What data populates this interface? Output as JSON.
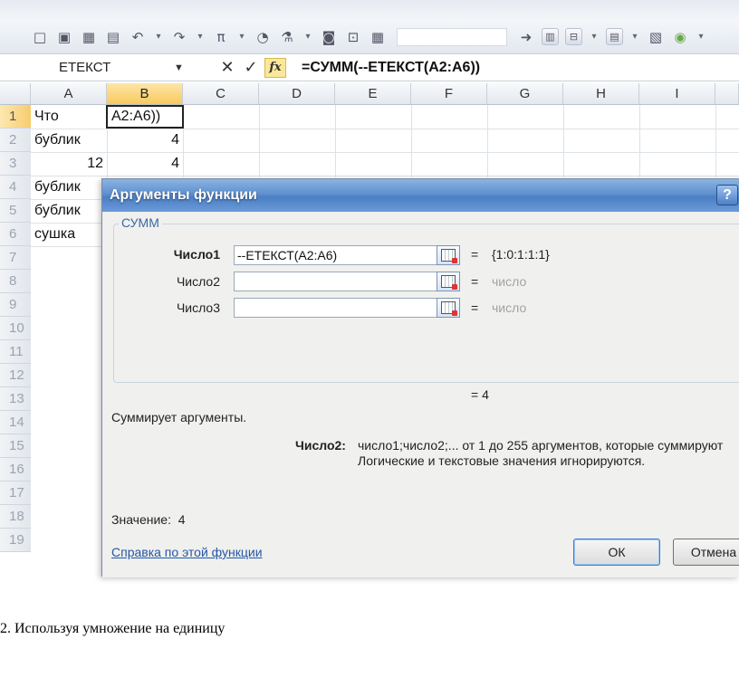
{
  "toolbar": {
    "icons": [
      "document-icon",
      "save-icon",
      "print-icon",
      "print-preview-icon",
      "undo-icon",
      "redo-icon",
      "pi-icon",
      "chart-icon",
      "filter-icon",
      "camera-icon",
      "lock-icon",
      "grid-icon",
      "arrow-right-icon",
      "fill-icon",
      "sort-icon",
      "format-icon",
      "macro-icon",
      "circle-icon",
      "customize-icon"
    ],
    "glyphs": {
      "document": "□",
      "save": "▣",
      "print": "▦",
      "preview": "▤",
      "undo": "↶",
      "redo": "↷",
      "pi": "π",
      "chart": "◔",
      "filter": "⚗",
      "camera": "◙",
      "lock": "⊡",
      "grid": "▦",
      "arrow": "➜",
      "fill": "▥",
      "sort": "⊟",
      "format": "▤",
      "macro": "▧",
      "circle": "◉",
      "more": "▾"
    }
  },
  "formula_bar": {
    "name_box": "ЕТЕКСТ",
    "dropdown": "▼",
    "cancel": "✕",
    "enter": "✓",
    "fx": "fx",
    "formula": "=СУММ(--ЕТЕКСТ(A2:A6))"
  },
  "sheet": {
    "columns": [
      "A",
      "B",
      "C",
      "D",
      "E",
      "F",
      "G",
      "H",
      "I"
    ],
    "rows": [
      "1",
      "2",
      "3",
      "4",
      "5",
      "6",
      "7",
      "8",
      "9",
      "10",
      "11",
      "12",
      "13",
      "14",
      "15",
      "16",
      "17",
      "18",
      "19"
    ],
    "cells": {
      "a1": "Что",
      "b1": "A2:A6))",
      "a2": "бублик",
      "b2": "4",
      "a3": "12",
      "b3": "4",
      "a4": "бублик",
      "a5": "бублик",
      "a6": "сушка"
    }
  },
  "dialog": {
    "title": "Аргументы функции",
    "help": "?",
    "function_name": "СУММ",
    "args": [
      {
        "label": "Число1",
        "value": "--ЕТЕКСТ(A2:A6)",
        "eq": "=",
        "result": "{1:0:1:1:1}"
      },
      {
        "label": "Число2",
        "value": "",
        "eq": "=",
        "result": "число"
      },
      {
        "label": "Число3",
        "value": "",
        "eq": "=",
        "result": "число"
      }
    ],
    "total": "=  4",
    "description": "Суммирует аргументы.",
    "arg_desc_label": "Число2:",
    "arg_desc_line1": "число1;число2;... от 1 до 255 аргументов, которые суммируют",
    "arg_desc_line2": "Логические и текстовые значения игнорируются.",
    "value_label": "Значение:",
    "value": "4",
    "help_link": "Справка по этой функции",
    "ok": "ОК",
    "cancel": "Отмена"
  },
  "caption": "2. Используя умножение на единицу"
}
